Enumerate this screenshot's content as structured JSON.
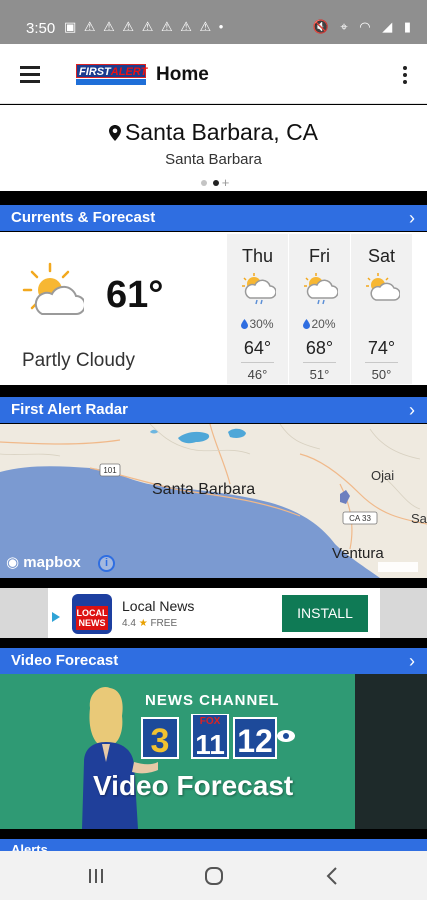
{
  "status_bar": {
    "time": "3:50",
    "left_icons": "▣ ⚠ ⚠ ⚠ ⚠ ⚠ ⚠ ⚠ •",
    "right_icons": "🔇 ⌖ ◠ ◢ ▮"
  },
  "app_bar": {
    "logo_text_first": "FIRST",
    "logo_text_alert": "ALERT",
    "title": "Home"
  },
  "location": {
    "name": "Santa Barbara, CA",
    "subtitle": "Santa Barbara"
  },
  "sections": {
    "currents": "Currents & Forecast",
    "radar": "First Alert Radar",
    "video": "Video Forecast",
    "alerts": "Alerts"
  },
  "current": {
    "temp": "61°",
    "condition": "Partly Cloudy",
    "icon": "partly-cloudy-icon"
  },
  "forecast": [
    {
      "day": "Thu",
      "precip": "30%",
      "hi": "64°",
      "lo": "46°",
      "icon": "showers-icon"
    },
    {
      "day": "Fri",
      "precip": "20%",
      "hi": "68°",
      "lo": "51°",
      "icon": "showers-icon"
    },
    {
      "day": "Sat",
      "precip": "",
      "hi": "74°",
      "lo": "50°",
      "icon": "partly-cloudy-icon"
    }
  ],
  "map": {
    "labels": {
      "city1": "Santa Barbara",
      "city2": "Ventura",
      "city3": "Ojai",
      "city4": "Sa",
      "hwy101": "101",
      "hwy33": "CA 33"
    },
    "attribution": "mapbox",
    "info": "i"
  },
  "ad": {
    "app_name": "Local News",
    "rating": "4.4",
    "price": "FREE",
    "install": "INSTALL",
    "icon_top": "LOCAL",
    "icon_bottom": "NEWS"
  },
  "video": {
    "channel": "NEWS CHANNEL",
    "title": "Video Forecast",
    "logo3": "3",
    "logo11": "11",
    "logo12": "12",
    "fox": "FOX"
  },
  "colors": {
    "accent": "#2f6ee1",
    "install": "#0f7a55",
    "video_bg": "#2f9a74"
  }
}
